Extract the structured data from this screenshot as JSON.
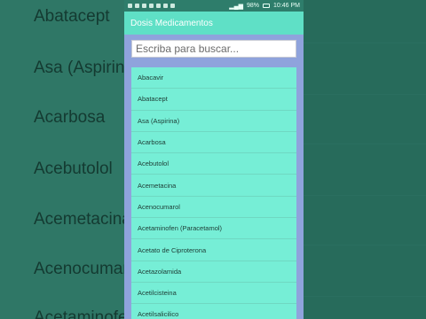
{
  "background": {
    "left_words": [
      "Abatacept",
      "Asa (Aspirina",
      "Acarbosa",
      "Acebutolol",
      "Acemetacina",
      "Acenocumar",
      "Acetaminofen"
    ]
  },
  "statusbar": {
    "battery": "98%",
    "time": "10:46 PM"
  },
  "app": {
    "title": "Dosis Medicamentos"
  },
  "search": {
    "placeholder": "Escriba para buscar..."
  },
  "list": {
    "items": [
      "Abacavir",
      "Abatacept",
      "Asa (Aspirina)",
      "Acarbosa",
      "Acebutolol",
      "Acemetacina",
      "Acenocumarol",
      "Acetaminofen (Paracetamol)",
      "Acetato de Ciproterona",
      "Acetazolamida",
      "Acetilcisteina",
      "Acetilsalicilico"
    ]
  },
  "colors": {
    "appbar": "#5fe0c6",
    "list_bg": "#76eed6",
    "page_bg": "#8fa3dc"
  }
}
